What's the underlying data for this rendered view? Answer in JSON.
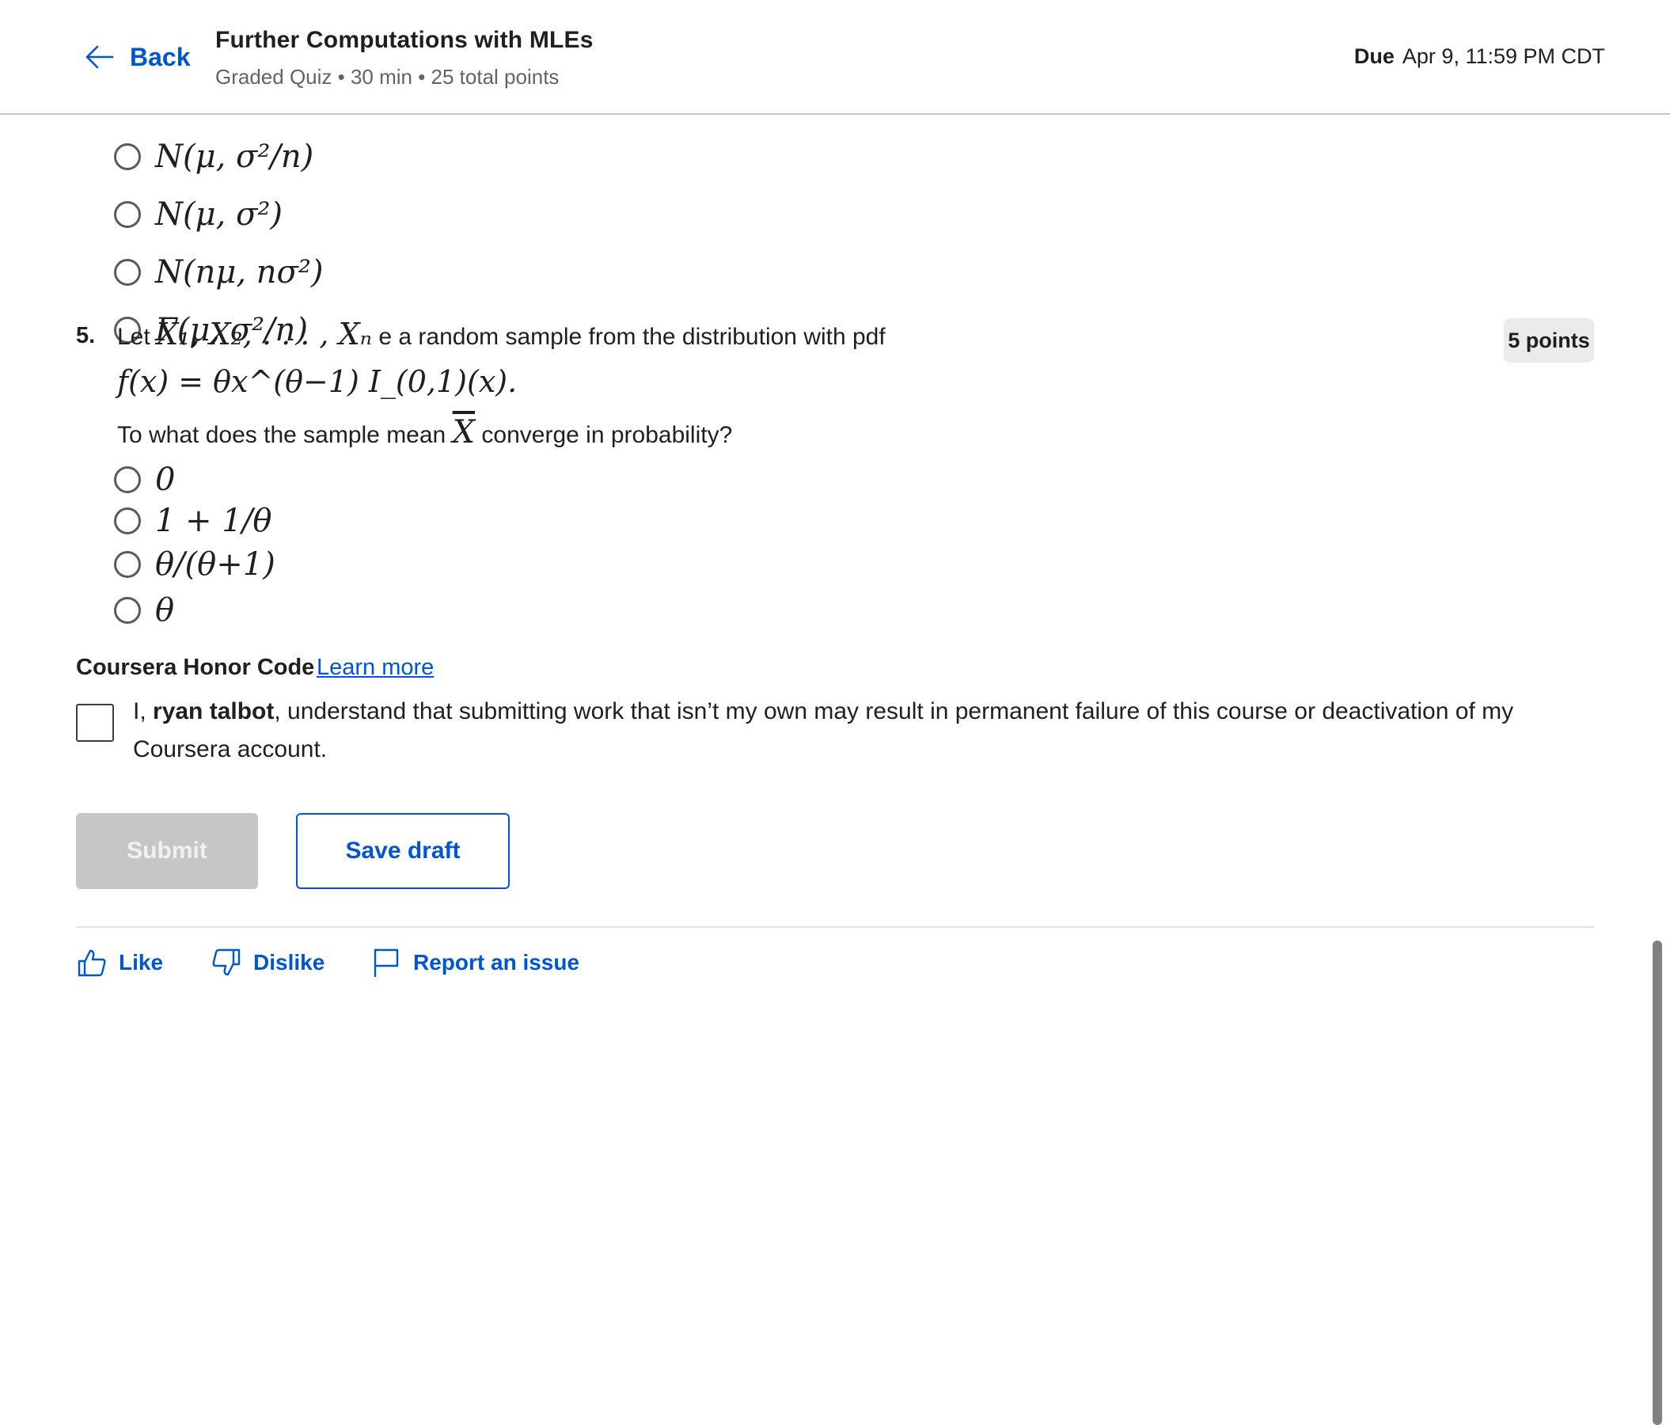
{
  "header": {
    "back_label": "Back",
    "title": "Further Computations with MLEs",
    "subtitle": "Graded Quiz • 30 min • 25 total points",
    "due_label": "Due",
    "due_value": "Apr 9, 11:59 PM CDT"
  },
  "question4": {
    "options": [
      "N(μ, σ²/n)",
      "N(μ, σ²)",
      "N(nμ, nσ²)",
      "Γ(μ, σ²/n)"
    ]
  },
  "question5": {
    "number": "5.",
    "stem_prefix": "Let",
    "stem_vars": "X₁, X₂, . . . , Xₙ",
    "stem_suffix": "e a random sample from the distribution with pdf",
    "formula": "f(x) = θx^(θ−1) I_(0,1)(x).",
    "ask_prefix": "To what does the sample mean",
    "ask_var": "X",
    "ask_suffix": "converge in probability?",
    "points": "5 points",
    "options": [
      "0",
      "1 + 1/θ",
      "θ/(θ+1)",
      "θ"
    ]
  },
  "honor": {
    "title": "Coursera Honor Code",
    "learn_more": "Learn more",
    "text_prefix": "I,",
    "user_name": "ryan talbot",
    "text_suffix": ", understand that submitting work that isn’t my own may result in permanent failure of this course or deactivation of my Coursera account."
  },
  "actions": {
    "submit": "Submit",
    "save_draft": "Save draft"
  },
  "footer": {
    "like": "Like",
    "dislike": "Dislike",
    "report": "Report an issue"
  },
  "colors": {
    "accent": "#0056d2",
    "disabled_button": "#c6c6c6"
  }
}
